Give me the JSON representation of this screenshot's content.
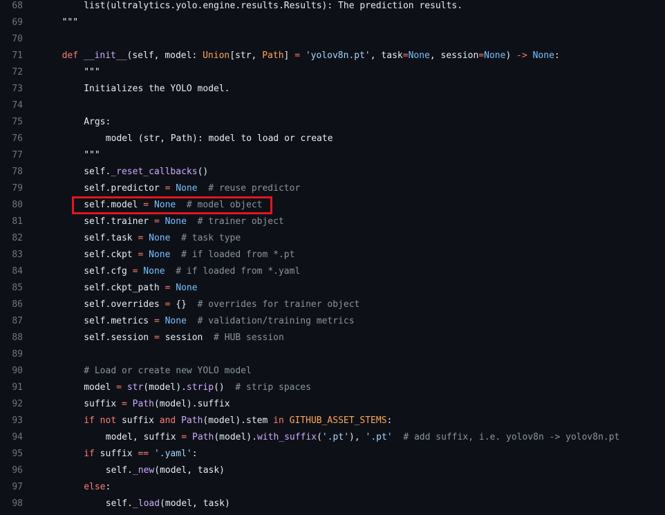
{
  "viewer": {
    "highlight_color": "#e3161f",
    "background": "#0d1117"
  },
  "lines": [
    {
      "num": "68",
      "indent": 2,
      "tokens": [
        {
          "t": "list(ultralytics.yolo.engine.results.Results): The prediction results.",
          "c": "plain"
        }
      ]
    },
    {
      "num": "69",
      "indent": 1,
      "tokens": [
        {
          "t": "\"\"\"",
          "c": "plain"
        }
      ]
    },
    {
      "num": "70",
      "indent": 0,
      "tokens": []
    },
    {
      "num": "71",
      "indent": 1,
      "tokens": [
        {
          "t": "def",
          "c": "kw"
        },
        {
          "t": " ",
          "c": "plain"
        },
        {
          "t": "__init__",
          "c": "fn"
        },
        {
          "t": "(self, model: ",
          "c": "plain"
        },
        {
          "t": "Union",
          "c": "cls"
        },
        {
          "t": "[str, ",
          "c": "plain"
        },
        {
          "t": "Path",
          "c": "cls"
        },
        {
          "t": "] ",
          "c": "plain"
        },
        {
          "t": "=",
          "c": "op"
        },
        {
          "t": " ",
          "c": "plain"
        },
        {
          "t": "'yolov8n.pt'",
          "c": "str"
        },
        {
          "t": ", task",
          "c": "plain"
        },
        {
          "t": "=",
          "c": "op"
        },
        {
          "t": "None",
          "c": "const"
        },
        {
          "t": ", session",
          "c": "plain"
        },
        {
          "t": "=",
          "c": "op"
        },
        {
          "t": "None",
          "c": "const"
        },
        {
          "t": ") ",
          "c": "plain"
        },
        {
          "t": "->",
          "c": "op"
        },
        {
          "t": " ",
          "c": "plain"
        },
        {
          "t": "None",
          "c": "const"
        },
        {
          "t": ":",
          "c": "plain"
        }
      ]
    },
    {
      "num": "72",
      "indent": 2,
      "tokens": [
        {
          "t": "\"\"\"",
          "c": "plain"
        }
      ]
    },
    {
      "num": "73",
      "indent": 2,
      "tokens": [
        {
          "t": "Initializes the YOLO model.",
          "c": "plain"
        }
      ]
    },
    {
      "num": "74",
      "indent": 0,
      "tokens": []
    },
    {
      "num": "75",
      "indent": 2,
      "tokens": [
        {
          "t": "Args:",
          "c": "plain"
        }
      ]
    },
    {
      "num": "76",
      "indent": 3,
      "tokens": [
        {
          "t": "model (str, Path): model to load or create",
          "c": "plain"
        }
      ]
    },
    {
      "num": "77",
      "indent": 2,
      "tokens": [
        {
          "t": "\"\"\"",
          "c": "plain"
        }
      ]
    },
    {
      "num": "78",
      "indent": 2,
      "tokens": [
        {
          "t": "self.",
          "c": "plain"
        },
        {
          "t": "_reset_callbacks",
          "c": "fn"
        },
        {
          "t": "()",
          "c": "plain"
        }
      ]
    },
    {
      "num": "79",
      "indent": 2,
      "tokens": [
        {
          "t": "self.predictor ",
          "c": "plain"
        },
        {
          "t": "=",
          "c": "op"
        },
        {
          "t": " ",
          "c": "plain"
        },
        {
          "t": "None",
          "c": "const"
        },
        {
          "t": "  ",
          "c": "plain"
        },
        {
          "t": "# reuse predictor",
          "c": "cm"
        }
      ]
    },
    {
      "num": "80",
      "indent": 2,
      "highlighted": true,
      "tokens": [
        {
          "t": "self.model ",
          "c": "plain"
        },
        {
          "t": "=",
          "c": "op"
        },
        {
          "t": " ",
          "c": "plain"
        },
        {
          "t": "None",
          "c": "const"
        },
        {
          "t": "  ",
          "c": "plain"
        },
        {
          "t": "# model object",
          "c": "cm"
        }
      ]
    },
    {
      "num": "81",
      "indent": 2,
      "tokens": [
        {
          "t": "self.trainer ",
          "c": "plain"
        },
        {
          "t": "=",
          "c": "op"
        },
        {
          "t": " ",
          "c": "plain"
        },
        {
          "t": "None",
          "c": "const"
        },
        {
          "t": "  ",
          "c": "plain"
        },
        {
          "t": "# trainer object",
          "c": "cm"
        }
      ]
    },
    {
      "num": "82",
      "indent": 2,
      "tokens": [
        {
          "t": "self.task ",
          "c": "plain"
        },
        {
          "t": "=",
          "c": "op"
        },
        {
          "t": " ",
          "c": "plain"
        },
        {
          "t": "None",
          "c": "const"
        },
        {
          "t": "  ",
          "c": "plain"
        },
        {
          "t": "# task type",
          "c": "cm"
        }
      ]
    },
    {
      "num": "83",
      "indent": 2,
      "tokens": [
        {
          "t": "self.ckpt ",
          "c": "plain"
        },
        {
          "t": "=",
          "c": "op"
        },
        {
          "t": " ",
          "c": "plain"
        },
        {
          "t": "None",
          "c": "const"
        },
        {
          "t": "  ",
          "c": "plain"
        },
        {
          "t": "# if loaded from *.pt",
          "c": "cm"
        }
      ]
    },
    {
      "num": "84",
      "indent": 2,
      "tokens": [
        {
          "t": "self.cfg ",
          "c": "plain"
        },
        {
          "t": "=",
          "c": "op"
        },
        {
          "t": " ",
          "c": "plain"
        },
        {
          "t": "None",
          "c": "const"
        },
        {
          "t": "  ",
          "c": "plain"
        },
        {
          "t": "# if loaded from *.yaml",
          "c": "cm"
        }
      ]
    },
    {
      "num": "85",
      "indent": 2,
      "tokens": [
        {
          "t": "self.ckpt_path ",
          "c": "plain"
        },
        {
          "t": "=",
          "c": "op"
        },
        {
          "t": " ",
          "c": "plain"
        },
        {
          "t": "None",
          "c": "const"
        }
      ]
    },
    {
      "num": "86",
      "indent": 2,
      "tokens": [
        {
          "t": "self.overrides ",
          "c": "plain"
        },
        {
          "t": "=",
          "c": "op"
        },
        {
          "t": " {}  ",
          "c": "plain"
        },
        {
          "t": "# overrides for trainer object",
          "c": "cm"
        }
      ]
    },
    {
      "num": "87",
      "indent": 2,
      "tokens": [
        {
          "t": "self.metrics ",
          "c": "plain"
        },
        {
          "t": "=",
          "c": "op"
        },
        {
          "t": " ",
          "c": "plain"
        },
        {
          "t": "None",
          "c": "const"
        },
        {
          "t": "  ",
          "c": "plain"
        },
        {
          "t": "# validation/training metrics",
          "c": "cm"
        }
      ]
    },
    {
      "num": "88",
      "indent": 2,
      "tokens": [
        {
          "t": "self.session ",
          "c": "plain"
        },
        {
          "t": "=",
          "c": "op"
        },
        {
          "t": " session  ",
          "c": "plain"
        },
        {
          "t": "# HUB session",
          "c": "cm"
        }
      ]
    },
    {
      "num": "89",
      "indent": 0,
      "tokens": []
    },
    {
      "num": "90",
      "indent": 2,
      "tokens": [
        {
          "t": "# Load or create new YOLO model",
          "c": "cm"
        }
      ]
    },
    {
      "num": "91",
      "indent": 2,
      "tokens": [
        {
          "t": "model ",
          "c": "plain"
        },
        {
          "t": "=",
          "c": "op"
        },
        {
          "t": " ",
          "c": "plain"
        },
        {
          "t": "str",
          "c": "fn"
        },
        {
          "t": "(model).",
          "c": "plain"
        },
        {
          "t": "strip",
          "c": "fn"
        },
        {
          "t": "()  ",
          "c": "plain"
        },
        {
          "t": "# strip spaces",
          "c": "cm"
        }
      ]
    },
    {
      "num": "92",
      "indent": 2,
      "tokens": [
        {
          "t": "suffix ",
          "c": "plain"
        },
        {
          "t": "=",
          "c": "op"
        },
        {
          "t": " ",
          "c": "plain"
        },
        {
          "t": "Path",
          "c": "fn"
        },
        {
          "t": "(model).suffix",
          "c": "plain"
        }
      ]
    },
    {
      "num": "93",
      "indent": 2,
      "tokens": [
        {
          "t": "if",
          "c": "kw"
        },
        {
          "t": " ",
          "c": "plain"
        },
        {
          "t": "not",
          "c": "kw"
        },
        {
          "t": " suffix ",
          "c": "plain"
        },
        {
          "t": "and",
          "c": "kw"
        },
        {
          "t": " ",
          "c": "plain"
        },
        {
          "t": "Path",
          "c": "fn"
        },
        {
          "t": "(model).stem ",
          "c": "plain"
        },
        {
          "t": "in",
          "c": "kw"
        },
        {
          "t": " ",
          "c": "plain"
        },
        {
          "t": "GITHUB_ASSET_STEMS",
          "c": "cls"
        },
        {
          "t": ":",
          "c": "plain"
        }
      ]
    },
    {
      "num": "94",
      "indent": 3,
      "tokens": [
        {
          "t": "model, suffix ",
          "c": "plain"
        },
        {
          "t": "=",
          "c": "op"
        },
        {
          "t": " ",
          "c": "plain"
        },
        {
          "t": "Path",
          "c": "fn"
        },
        {
          "t": "(model).",
          "c": "plain"
        },
        {
          "t": "with_suffix",
          "c": "fn"
        },
        {
          "t": "(",
          "c": "plain"
        },
        {
          "t": "'.pt'",
          "c": "str"
        },
        {
          "t": "), ",
          "c": "plain"
        },
        {
          "t": "'.pt'",
          "c": "str"
        },
        {
          "t": "  ",
          "c": "plain"
        },
        {
          "t": "# add suffix, i.e. yolov8n -> yolov8n.pt",
          "c": "cm"
        }
      ]
    },
    {
      "num": "95",
      "indent": 2,
      "tokens": [
        {
          "t": "if",
          "c": "kw"
        },
        {
          "t": " suffix ",
          "c": "plain"
        },
        {
          "t": "==",
          "c": "op"
        },
        {
          "t": " ",
          "c": "plain"
        },
        {
          "t": "'.yaml'",
          "c": "str"
        },
        {
          "t": ":",
          "c": "plain"
        }
      ]
    },
    {
      "num": "96",
      "indent": 3,
      "tokens": [
        {
          "t": "self.",
          "c": "plain"
        },
        {
          "t": "_new",
          "c": "fn"
        },
        {
          "t": "(model, task)",
          "c": "plain"
        }
      ]
    },
    {
      "num": "97",
      "indent": 2,
      "tokens": [
        {
          "t": "else",
          "c": "kw"
        },
        {
          "t": ":",
          "c": "plain"
        }
      ]
    },
    {
      "num": "98",
      "indent": 3,
      "tokens": [
        {
          "t": "self.",
          "c": "plain"
        },
        {
          "t": "_load",
          "c": "fn"
        },
        {
          "t": "(model, task)",
          "c": "plain"
        }
      ]
    }
  ]
}
